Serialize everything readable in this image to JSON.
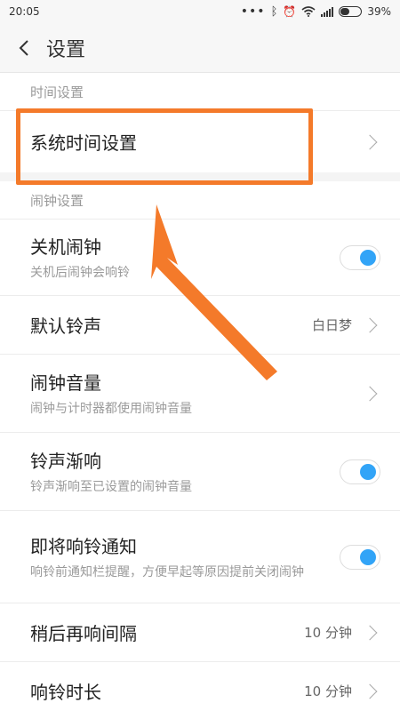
{
  "status_bar": {
    "time": "20:05",
    "battery_percent": "39%",
    "battery_level": 0.39
  },
  "app_bar": {
    "title": "设置"
  },
  "sections": {
    "time": {
      "header": "时间设置",
      "system_time": {
        "title": "系统时间设置"
      }
    },
    "alarm": {
      "header": "闹钟设置",
      "power_off_alarm": {
        "title": "关机闹钟",
        "subtitle": "关机后闹钟会响铃",
        "enabled": true
      },
      "default_ringtone": {
        "title": "默认铃声",
        "value": "白日梦"
      },
      "alarm_volume": {
        "title": "闹钟音量",
        "subtitle": "闹钟与计时器都使用闹钟音量"
      },
      "gradual_ring": {
        "title": "铃声渐响",
        "subtitle": "铃声渐响至已设置的闹钟音量",
        "enabled": true
      },
      "upcoming_notice": {
        "title": "即将响铃通知",
        "subtitle": "响铃前通知栏提醒，方便早起等原因提前关闭闹钟",
        "enabled": true
      },
      "snooze_interval": {
        "title": "稍后再响间隔",
        "value": "10 分钟"
      },
      "ring_duration": {
        "title": "响铃时长",
        "value": "10 分钟"
      }
    }
  },
  "colors": {
    "accent": "#f47a2a",
    "toggle_on": "#32a4f7"
  }
}
